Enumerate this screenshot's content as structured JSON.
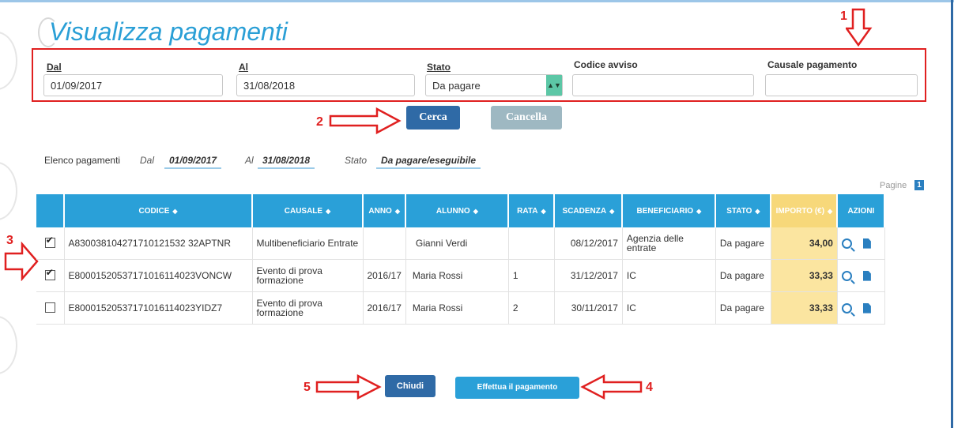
{
  "page": {
    "title": "Visualizza pagamenti"
  },
  "filters": {
    "dal": {
      "label": "Dal",
      "value": "01/09/2017"
    },
    "al": {
      "label": "Al",
      "value": "31/08/2018"
    },
    "stato": {
      "label": "Stato",
      "value": "Da pagare"
    },
    "codice_avviso": {
      "label": "Codice avviso",
      "value": ""
    },
    "causale": {
      "label": "Causale pagamento",
      "value": ""
    }
  },
  "buttons": {
    "cerca": "Cerca",
    "cancella": "Cancella",
    "chiudi": "Chiudi",
    "effettua": "Effettua il pagamento"
  },
  "summary": {
    "label": "Elenco pagamenti",
    "dal_label": "Dal",
    "dal_value": "01/09/2017",
    "al_label": "Al",
    "al_value": "31/08/2018",
    "stato_label": "Stato",
    "stato_value": "Da pagare/eseguibile"
  },
  "pagination": {
    "label": "Pagine",
    "current": "1"
  },
  "table": {
    "headers": [
      "CODICE",
      "CAUSALE",
      "ANNO",
      "ALUNNO",
      "RATA",
      "SCADENZA",
      "BENEFICIARIO",
      "STATO",
      "IMPORTO (€)",
      "AZIONI"
    ],
    "rows": [
      {
        "checked": true,
        "codice": "A830038104271710121532 32APTNR",
        "causale": "Multibeneficiario Entrate",
        "anno": "",
        "alunno": "Gianni Verdi",
        "rata": "",
        "scadenza": "08/12/2017",
        "beneficiario": "Agenzia delle entrate",
        "stato": "Da pagare",
        "importo": "34,00"
      },
      {
        "checked": true,
        "codice": "E80001520537171016114023VONCW",
        "causale": "Evento di prova formazione",
        "anno": "2016/17",
        "alunno": "Maria Rossi",
        "rata": "1",
        "scadenza": "31/12/2017",
        "beneficiario": "IC",
        "stato": "Da pagare",
        "importo": "33,33"
      },
      {
        "checked": false,
        "codice": "E80001520537171016114023YIDZ7",
        "causale": "Evento di prova formazione",
        "anno": "2016/17",
        "alunno": "Maria Rossi",
        "rata": "2",
        "scadenza": "30/11/2017",
        "beneficiario": "IC",
        "stato": "Da pagare",
        "importo": "33,33"
      }
    ]
  },
  "annotations": [
    "1",
    "2",
    "3",
    "4",
    "5"
  ],
  "colors": {
    "accent": "#2aa0d8",
    "annotation_red": "#e02020",
    "importo_bg": "#fbe5a0",
    "button_dark": "#2f6aa6"
  }
}
